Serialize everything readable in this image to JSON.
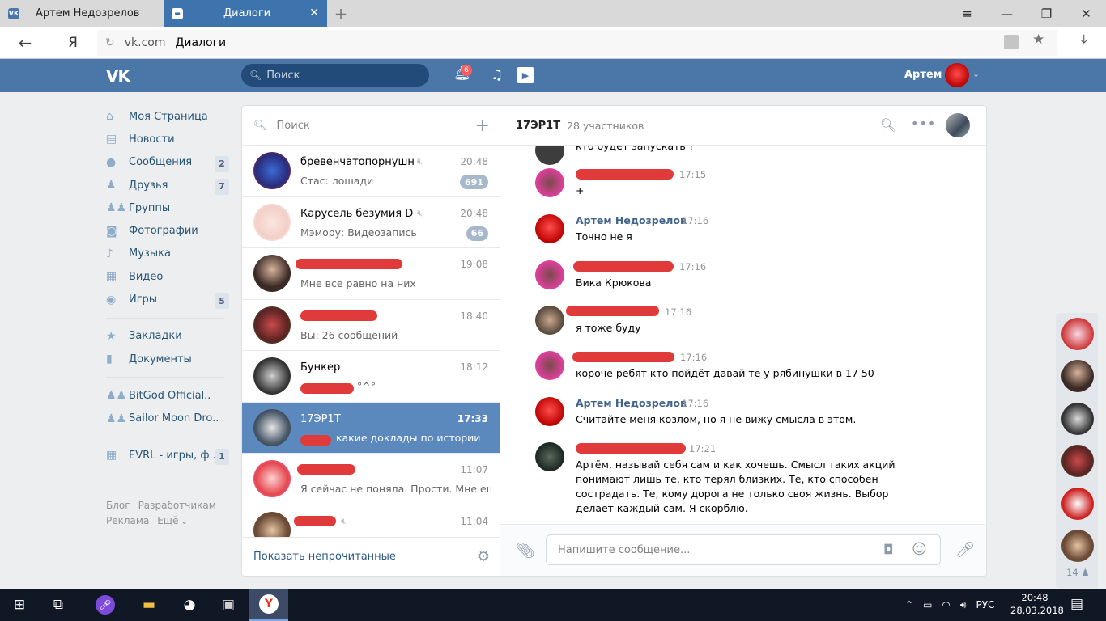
{
  "browser": {
    "tabs": [
      {
        "label": "Артем Недозрелов",
        "active": false
      },
      {
        "label": "Диалоги",
        "active": true
      }
    ],
    "url_domain": "vk.com",
    "url_path": "Диалоги",
    "ya_label": "Я"
  },
  "vk_header": {
    "logo": "VK",
    "search_placeholder": "Поиск",
    "notif_count": "6",
    "user_name": "Артем"
  },
  "left_nav": {
    "items": [
      {
        "label": "Моя Страница",
        "icon": "home-icon",
        "count": ""
      },
      {
        "label": "Новости",
        "icon": "news-icon",
        "count": ""
      },
      {
        "label": "Сообщения",
        "icon": "messages-icon",
        "count": "2"
      },
      {
        "label": "Друзья",
        "icon": "friends-icon",
        "count": "7"
      },
      {
        "label": "Группы",
        "icon": "groups-icon",
        "count": ""
      },
      {
        "label": "Фотографии",
        "icon": "camera-icon",
        "count": ""
      },
      {
        "label": "Музыка",
        "icon": "music-icon",
        "count": ""
      },
      {
        "label": "Видео",
        "icon": "video-icon",
        "count": ""
      },
      {
        "label": "Игры",
        "icon": "games-icon",
        "count": "5"
      }
    ],
    "items2": [
      {
        "label": "Закладки",
        "icon": "star-icon"
      },
      {
        "label": "Документы",
        "icon": "document-icon"
      }
    ],
    "communities": [
      {
        "label": "BitGod Official..",
        "icon": "community-icon"
      },
      {
        "label": "Sailor Moon Dro..",
        "icon": "community-icon"
      }
    ],
    "apps": [
      {
        "label": "EVRL - игры, ф...",
        "icon": "apps-icon",
        "count": "1"
      }
    ],
    "footer": [
      "Блог",
      "Разработчикам",
      "Реклама",
      "Ещё"
    ]
  },
  "dialogs": {
    "search_placeholder": "Поиск",
    "items": [
      {
        "name": "бревенчатопорнушн...",
        "time": "20:48",
        "preview": "Стас: лошади",
        "count": "691",
        "muted": true
      },
      {
        "name": "Карусель безумия DD...",
        "time": "20:48",
        "preview": "Мэмору: Видеозапись",
        "count": "66",
        "muted": true
      },
      {
        "name": "",
        "time": "19:08",
        "preview": "Мне все равно на них",
        "count": "",
        "muted": false
      },
      {
        "name": "",
        "time": "18:40",
        "preview": "Вы: 26 сообщений",
        "count": "",
        "muted": false
      },
      {
        "name": "Бункер",
        "time": "18:12",
        "preview": "°^°",
        "count": "",
        "muted": false
      },
      {
        "name": "17ЭР1Т",
        "time": "17:33",
        "preview": "какие доклады по истории",
        "count": "",
        "muted": false
      },
      {
        "name": "",
        "time": "11:07",
        "preview": "Я сейчас не поняла. Прости. Мне ещё...",
        "count": "",
        "muted": false
      },
      {
        "name": "",
        "time": "11:04",
        "preview": "",
        "count": "",
        "muted": true
      }
    ],
    "footer_link": "Показать непрочитанные"
  },
  "chat": {
    "title": "17ЭР1Т",
    "members": "28 участников",
    "top_partial": "кто будет запускать ?",
    "messages": [
      {
        "author": "",
        "time": "17:15",
        "text": "+"
      },
      {
        "author": "Артем Недозрелов",
        "time": "17:16",
        "text": "Точно не я"
      },
      {
        "author": "",
        "time": "17:16",
        "text": "Вика Крюкова"
      },
      {
        "author": "",
        "time": "17:16",
        "text": "я тоже буду"
      },
      {
        "author": "",
        "time": "17:16",
        "text": "короче ребят кто пойдёт давай те у рябинушки в 17 50"
      },
      {
        "author": "Артем Недозрелов",
        "time": "17:16",
        "text": "Считайте меня козлом, но я не вижу смысла в этом."
      },
      {
        "author": "",
        "time": "17:21",
        "text": "Артём, называй себя сам и как хочешь. Смысл таких акций понимают лишь те, кто терял близких. Те, кто способен сострадать. Те, кому дорога не только своя жизнь. Выбор делает каждый сам. Я скорблю."
      }
    ],
    "input_placeholder": "Напишите сообщение..."
  },
  "right_strip": {
    "count": "14"
  },
  "taskbar": {
    "lang": "РУС",
    "time": "20:48",
    "date": "28.03.2018"
  }
}
